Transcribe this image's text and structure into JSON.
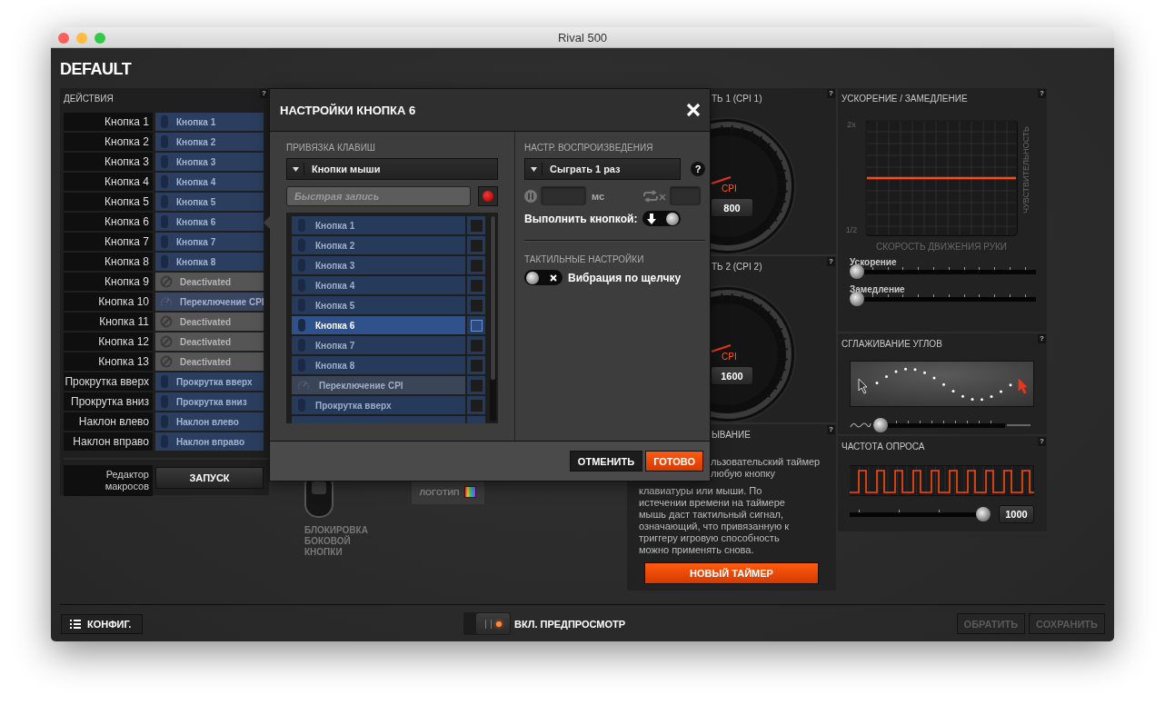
{
  "window": {
    "title": "Rival 500"
  },
  "profile_name": "DEFAULT",
  "actions_panel": {
    "title": "ДЕЙСТВИЯ",
    "help": "?",
    "rows": [
      {
        "button": "Кнопка 1",
        "action": "Кнопка 1",
        "kind": "mouse"
      },
      {
        "button": "Кнопка 2",
        "action": "Кнопка 2",
        "kind": "mouse"
      },
      {
        "button": "Кнопка 3",
        "action": "Кнопка 3",
        "kind": "mouse"
      },
      {
        "button": "Кнопка 4",
        "action": "Кнопка 4",
        "kind": "mouse"
      },
      {
        "button": "Кнопка 5",
        "action": "Кнопка 5",
        "kind": "mouse"
      },
      {
        "button": "Кнопка 6",
        "action": "Кнопка 6",
        "kind": "mouse"
      },
      {
        "button": "Кнопка 7",
        "action": "Кнопка 7",
        "kind": "mouse"
      },
      {
        "button": "Кнопка 8",
        "action": "Кнопка 8",
        "kind": "mouse"
      },
      {
        "button": "Кнопка 9",
        "action": "Deactivated",
        "kind": "deactivated"
      },
      {
        "button": "Кнопка 10",
        "action": "Переключение CPI",
        "kind": "cpi"
      },
      {
        "button": "Кнопка 11",
        "action": "Deactivated",
        "kind": "deactivated"
      },
      {
        "button": "Кнопка 12",
        "action": "Deactivated",
        "kind": "deactivated"
      },
      {
        "button": "Кнопка 13",
        "action": "Deactivated",
        "kind": "deactivated"
      },
      {
        "button": "Прокрутка вверх",
        "action": "Прокрутка вверх",
        "kind": "mouse"
      },
      {
        "button": "Прокрутка вниз",
        "action": "Прокрутка вниз",
        "kind": "mouse"
      },
      {
        "button": "Наклон влево",
        "action": "Наклон влево",
        "kind": "mouse"
      },
      {
        "button": "Наклон вправо",
        "action": "Наклон вправо",
        "kind": "mouse"
      }
    ],
    "macro_editor": {
      "label": "Редактор\nмакросов",
      "button": "ЗАПУСК"
    }
  },
  "side_button_lock": {
    "label": "БЛОКИРОВКА\nБОКОВОЙ\nКНОПКИ"
  },
  "logo_tile": {
    "label": "ЛОГОТИП"
  },
  "cpi_panels": [
    {
      "title": "ТЬ 1 (CPI 1)",
      "help": "?",
      "unit": "CPI",
      "value": "800"
    },
    {
      "title": "ТЬ 2 (CPI 2)",
      "help": "?",
      "unit": "CPI",
      "value": "1600"
    }
  ],
  "timer_panel": {
    "title": "ЫВАНИЕ",
    "help": "?",
    "text_fragment": "льзовательский таймер\nлюбую кнопку",
    "text": "клавиатуры или мыши. По\nистечении времени на таймере\nмышь даст тактильный сигнал,\nозначающий, что привязанную к\nтриггеру игровую способность\nможно применять снова.",
    "button": "НОВЫЙ ТАЙМЕР"
  },
  "acceleration_panel": {
    "title": "УСКОРЕНИЕ / ЗАМЕДЛЕНИЕ",
    "help": "?",
    "y_top": "2x",
    "y_bottom": "1/2",
    "y_axis": "ЧУВСТВИТЕЛЬНОСТЬ",
    "x_axis": "СКОРОСТЬ ДВИЖЕНИЯ РУКИ",
    "sliders": [
      {
        "label": "Ускорение",
        "level": 0
      },
      {
        "label": "Замедление",
        "level": 0
      }
    ]
  },
  "angle_snapping_panel": {
    "title": "СГЛАЖИВАНИЕ УГЛОВ",
    "help": "?",
    "slider": {
      "level": 0
    }
  },
  "polling_panel": {
    "title": "ЧАСТОТА ОПРОСА",
    "help": "?",
    "slider": {
      "level": 1
    },
    "value": "1000"
  },
  "dialog": {
    "title": "НАСТРОЙКИ КНОПКА 6",
    "key_binding": {
      "title": "ПРИВЯЗКА КЛАВИШ",
      "dropdown": "Кнопки мыши",
      "record_field": {
        "placeholder": "Быстрая запись"
      },
      "items": [
        {
          "label": "Кнопка 1",
          "kind": "mouse",
          "selected": false,
          "checked": false
        },
        {
          "label": "Кнопка 2",
          "kind": "mouse",
          "selected": false,
          "checked": false
        },
        {
          "label": "Кнопка 3",
          "kind": "mouse",
          "selected": false,
          "checked": false
        },
        {
          "label": "Кнопка 4",
          "kind": "mouse",
          "selected": false,
          "checked": false
        },
        {
          "label": "Кнопка 5",
          "kind": "mouse",
          "selected": false,
          "checked": false
        },
        {
          "label": "Кнопка 6",
          "kind": "mouse",
          "selected": true,
          "checked": false
        },
        {
          "label": "Кнопка 7",
          "kind": "mouse",
          "selected": false,
          "checked": false
        },
        {
          "label": "Кнопка 8",
          "kind": "mouse",
          "selected": false,
          "checked": false
        },
        {
          "label": "Переключение CPI",
          "kind": "cpi",
          "selected": false,
          "checked": false
        },
        {
          "label": "Прокрутка вверх",
          "kind": "mouse",
          "selected": false,
          "checked": false
        }
      ]
    },
    "playback": {
      "title": "НАСТР. ВОСПРОИЗВЕДЕНИЯ",
      "dropdown": "Сыграть 1 раз",
      "help": "?",
      "delay_unit": "мс",
      "execute_label": "Выполнить кнопкой:",
      "execute_on": true
    },
    "haptics": {
      "title": "ТАКТИЛЬНЫЕ НАСТРОЙКИ",
      "label": "Вибрация по щелчку",
      "on": false
    },
    "buttons": [
      {
        "label": "ОТМЕНИТЬ",
        "kind": "secondary"
      },
      {
        "label": "ГОТОВО",
        "kind": "primary"
      }
    ]
  },
  "footer": {
    "config_button": "КОНФИГ.",
    "preview": {
      "label": "ВКЛ. ПРЕДПРОСМОТР",
      "on": true
    },
    "buttons": [
      {
        "label": "ОБРАТИТЬ",
        "disabled": true
      },
      {
        "label": "СОХРАНИТЬ",
        "disabled": true
      }
    ]
  }
}
